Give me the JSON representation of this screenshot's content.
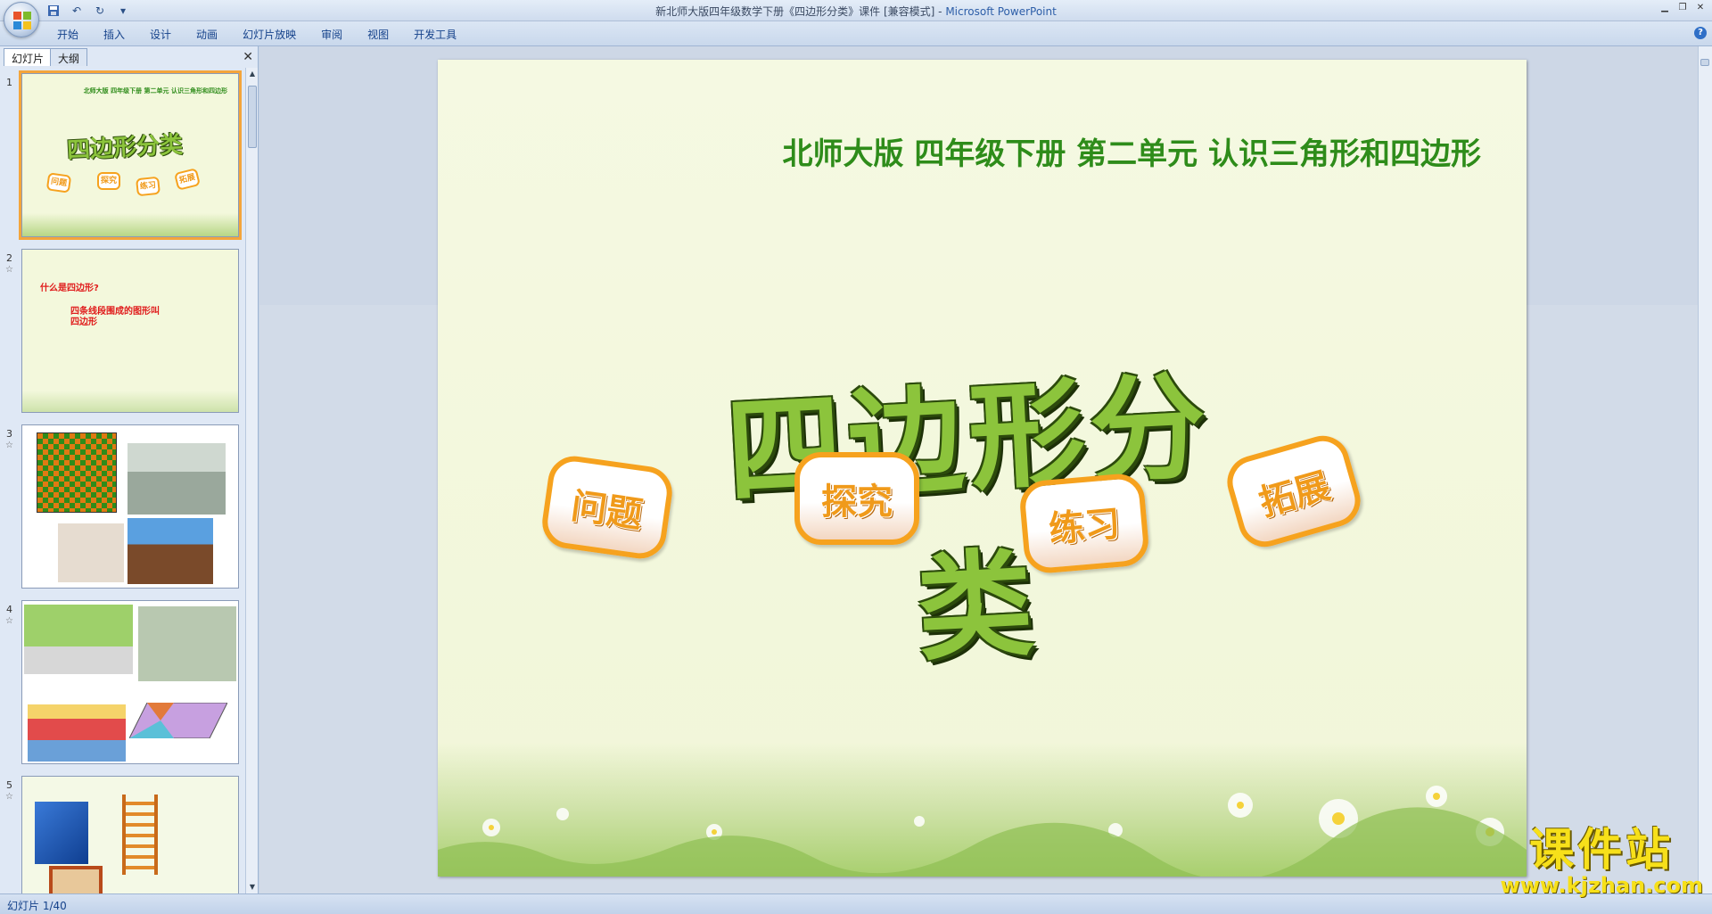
{
  "window": {
    "title": "新北师大版四年级数学下册《四边形分类》课件 [兼容模式]",
    "separator": " - ",
    "app_name": "Microsoft PowerPoint"
  },
  "ribbon": {
    "tabs": [
      "开始",
      "插入",
      "设计",
      "动画",
      "幻灯片放映",
      "审阅",
      "视图",
      "开发工具"
    ]
  },
  "panel": {
    "tab_slides": "幻灯片",
    "tab_outline": "大纲"
  },
  "thumbnails": [
    {
      "num": "1",
      "subtitle": "北师大版 四年级下册 第二单元 认识三角形和四边形",
      "title": "四边形分类",
      "buttons": [
        "问题",
        "探究",
        "练习",
        "拓展"
      ]
    },
    {
      "num": "2",
      "line1": "什么是四边形?",
      "line2": "四条线段围成的图形叫",
      "line3": "四边形"
    },
    {
      "num": "3"
    },
    {
      "num": "4"
    },
    {
      "num": "5"
    }
  ],
  "slide": {
    "subtitle": "北师大版  四年级下册  第二单元  认识三角形和四边形",
    "title": "四边形分类",
    "buttons": [
      "问题",
      "探究",
      "练习",
      "拓展"
    ]
  },
  "status": {
    "text": "幻灯片 1/40"
  },
  "watermark": {
    "cn": "课件站",
    "url": "www.kjzhan.com"
  },
  "colors": {
    "subtitle": "#2e8c1a",
    "title_fill": "#8cc43c",
    "badge_orange": "#f6a21e",
    "selected_outline": "#f4a53b"
  }
}
